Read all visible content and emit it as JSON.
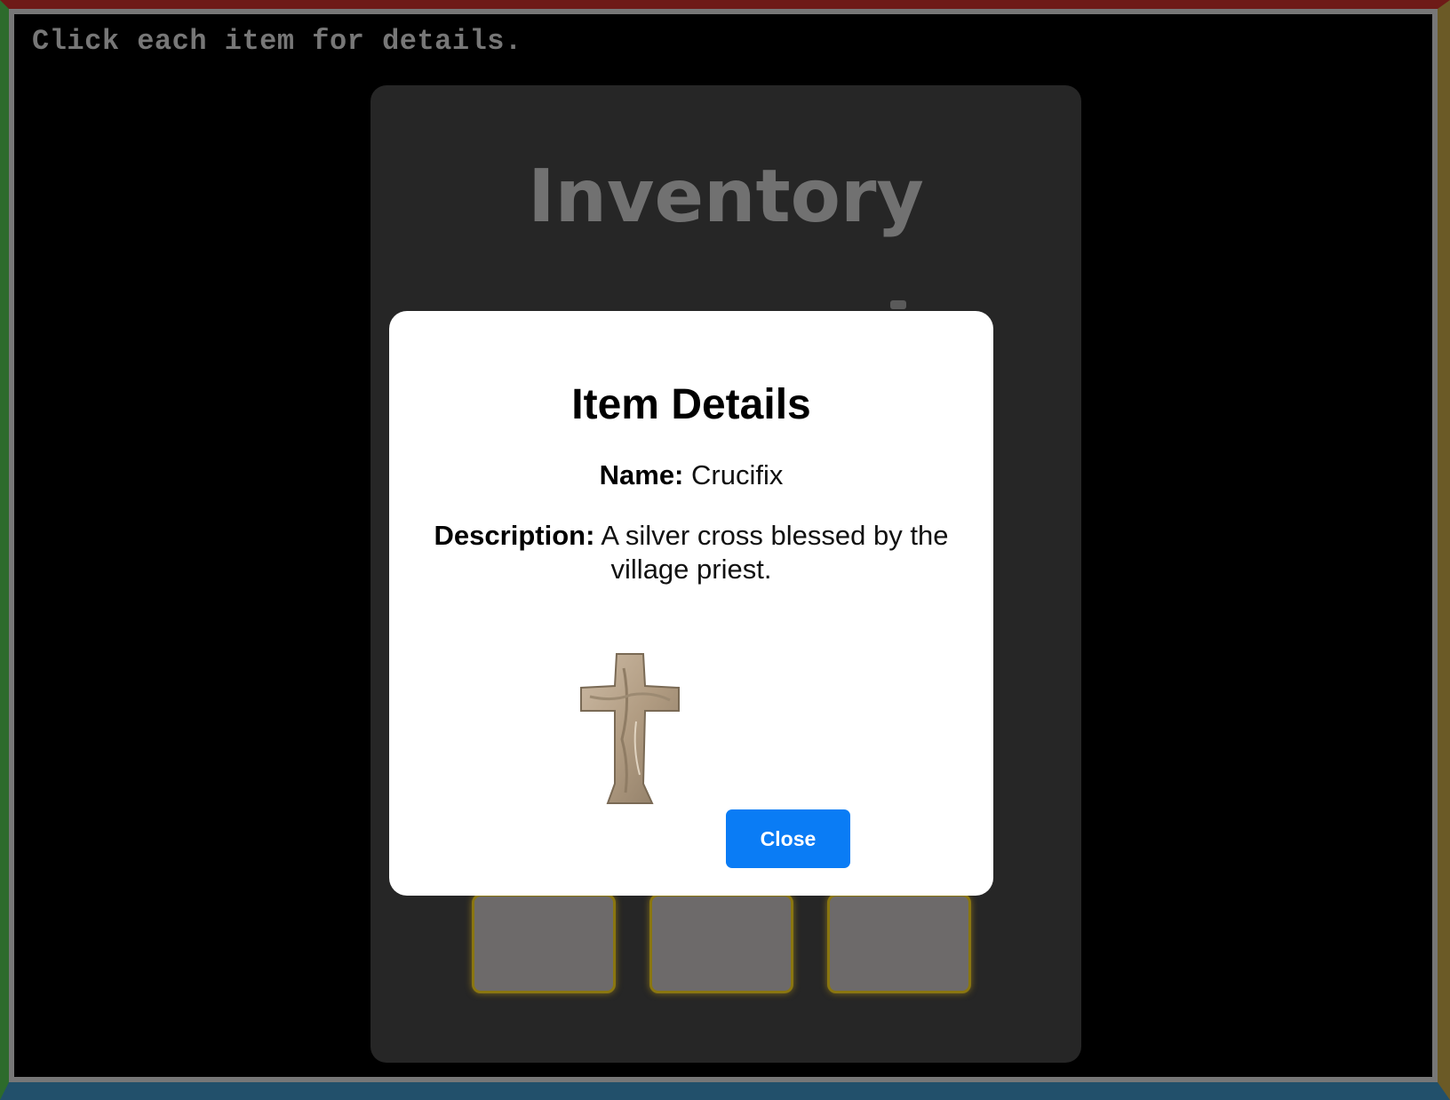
{
  "page": {
    "instruction": "Click each item for details."
  },
  "inventory": {
    "title": "Inventory",
    "slots": [
      "",
      "",
      ""
    ]
  },
  "modal": {
    "title": "Item Details",
    "name_label": "Name:",
    "name_value": "Crucifix",
    "description_label": "Description:",
    "description_value": "A silver cross blessed by the village priest.",
    "image_icon": "crucifix-icon",
    "close_label": "Close"
  },
  "colors": {
    "background": "#000000",
    "panel": "#262626",
    "slot": "#6d6a6a",
    "slot_border": "#8a7610",
    "modal": "#ffffff",
    "button": "#0a7cf5"
  }
}
